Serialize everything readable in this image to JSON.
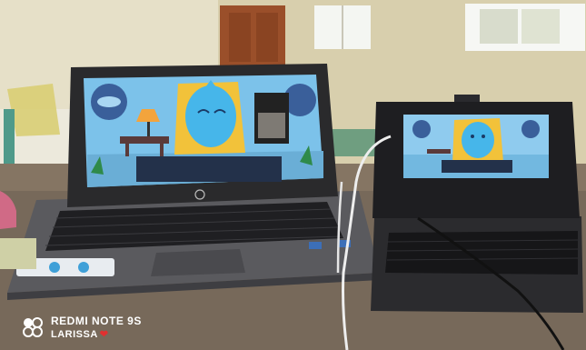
{
  "photo": {
    "description_colors": {
      "wall": "#d9d0ae",
      "table": "#7a6a58",
      "laptop_body": "#2a2a2c",
      "screen_bg": "#7fc3ea",
      "character": "#48b8ec",
      "chair": "#f2c23a"
    },
    "laptop": {
      "brand_logo": "hp"
    }
  },
  "watermark": {
    "device": "REDMI NOTE 9S",
    "owner": "LARISSA"
  }
}
